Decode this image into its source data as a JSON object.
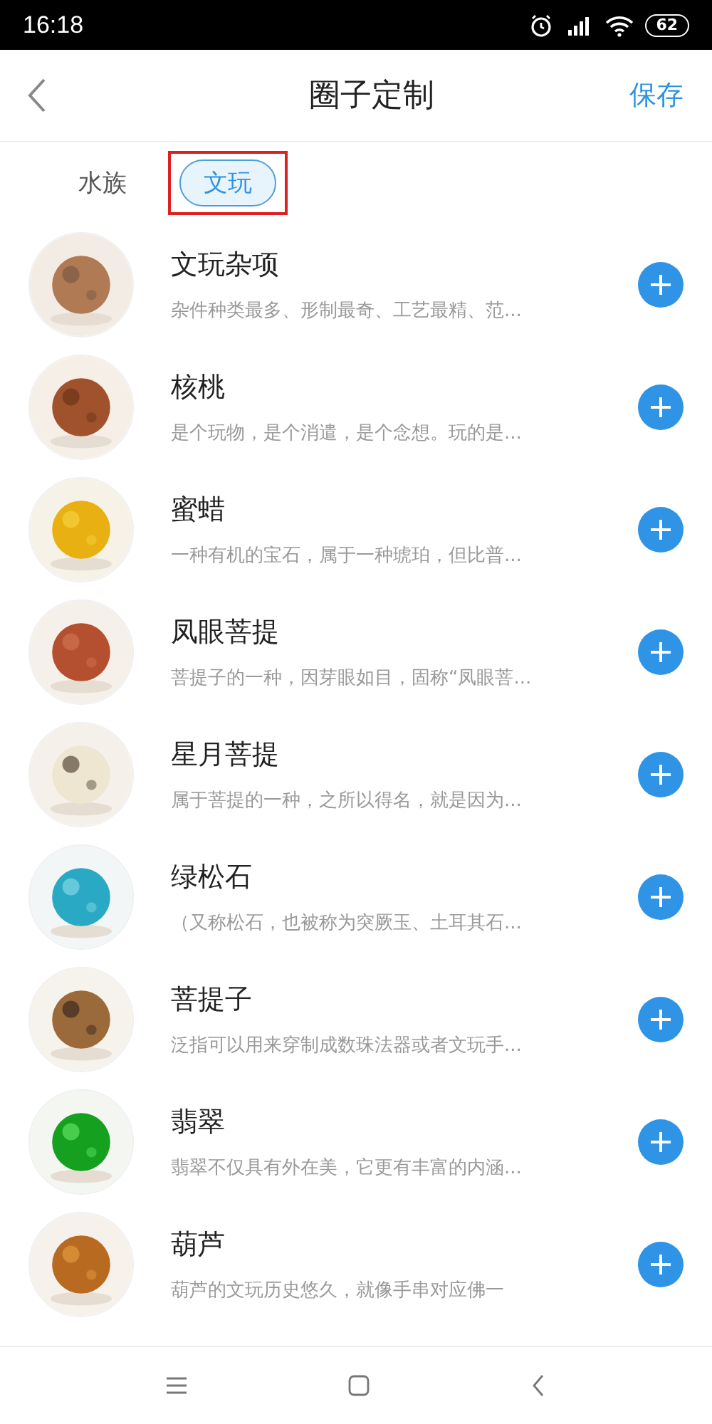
{
  "status_bar": {
    "time": "16:18",
    "battery": "62"
  },
  "header": {
    "title": "圈子定制",
    "action": "保存"
  },
  "tabs": [
    {
      "label": "水族",
      "selected": false,
      "highlighted": false
    },
    {
      "label": "文玩",
      "selected": true,
      "highlighted": true
    }
  ],
  "items": [
    {
      "name": "文玩杂项",
      "description": "杂件种类最多、形制最奇、工艺最精、范..."
    },
    {
      "name": "核桃",
      "description": "是个玩物，是个消遣，是个念想。玩的是..."
    },
    {
      "name": "蜜蜡",
      "description": "一种有机的宝石，属于一种琥珀，但比普..."
    },
    {
      "name": "凤眼菩提",
      "description": "菩提子的一种，因芽眼如目，固称“凤眼菩..."
    },
    {
      "name": "星月菩提",
      "description": "属于菩提的一种，之所以得名，就是因为..."
    },
    {
      "name": "绿松石",
      "description": "（又称松石，也被称为突厥玉、土耳其石..."
    },
    {
      "name": "菩提子",
      "description": "泛指可以用来穿制成数珠法器或者文玩手..."
    },
    {
      "name": "翡翠",
      "description": "翡翠不仅具有外在美，它更有丰富的内涵..."
    },
    {
      "name": "葫芦",
      "description": "葫芦的文玩历史悠久，就像手串对应佛一"
    }
  ]
}
